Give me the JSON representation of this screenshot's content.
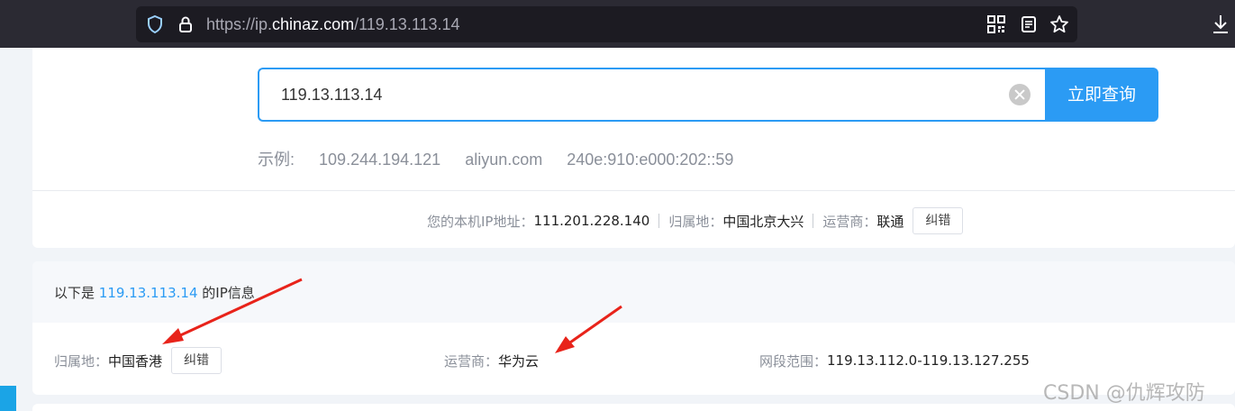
{
  "browser": {
    "url_scheme": "https://ip.",
    "url_host": "chinaz.com",
    "url_path": "/119.13.113.14"
  },
  "search": {
    "value": "119.13.113.14",
    "button_label": "立即查询"
  },
  "examples": {
    "label": "示例:",
    "items": [
      "109.244.194.121",
      "aliyun.com",
      "240e:910:e000:202::59"
    ]
  },
  "my_ip": {
    "ip_label": "您的本机IP地址：",
    "ip_value": "111.201.228.140",
    "location_label": "归属地：",
    "location_value": "中国北京大兴",
    "isp_label": "运营商：",
    "isp_value": "联通",
    "correct_label": "纠错"
  },
  "result": {
    "prefix": "以下是 ",
    "ip": "119.13.113.14",
    "suffix": " 的IP信息",
    "location_label": "归属地：",
    "location_value": "中国香港",
    "correct_label": "纠错",
    "isp_label": "运营商：",
    "isp_value": "华为云",
    "range_label": "网段范围：",
    "range_value": "119.13.112.0-119.13.127.255"
  },
  "watermark": "CSDN @仇辉攻防",
  "colors": {
    "accent": "#2b9bf4",
    "arrow": "#e8231a",
    "chrome": "#2b2a33"
  }
}
